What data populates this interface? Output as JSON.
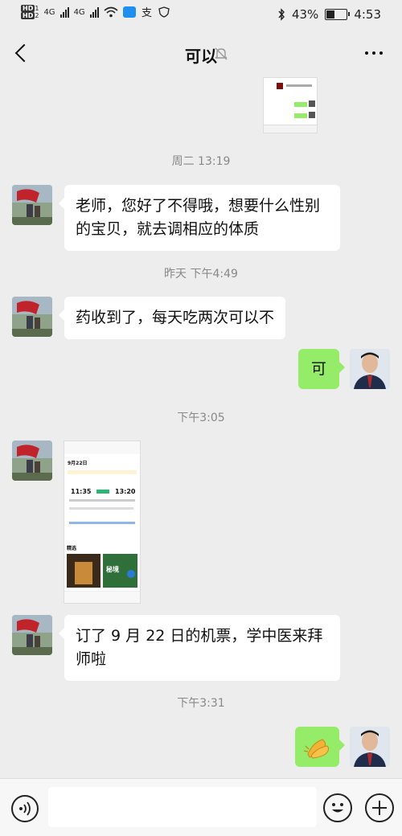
{
  "status_bar": {
    "hd1": "HD",
    "sim1": "1",
    "hd2": "HD",
    "sim2": "2",
    "net1": "4G",
    "net2": "4G",
    "battery": "43%",
    "battery_level": 0.43,
    "time": "4:53"
  },
  "header": {
    "title": "可以"
  },
  "messages": {
    "ts_1": "周二 13:19",
    "msg_1": "老师，您好了不得哦，想要什么性别的宝贝，就去调相应的体质",
    "ts_2": "昨天 下午4:49",
    "msg_2": "药收到了，每天吃两次可以不",
    "msg_3": "可",
    "ts_3": "下午3:05",
    "shot": {
      "date": "9月22日",
      "dep_time": "11:35",
      "arr_time": "13:20",
      "tab": "精选",
      "card_text": "秘境"
    },
    "msg_4": "订了 9 月 22 日的机票，学中医来拜师啦",
    "ts_4": "下午3:31"
  },
  "colors": {
    "bubble_self": "#95ec69",
    "bubble_other": "#ffffff",
    "background": "#ededed"
  }
}
